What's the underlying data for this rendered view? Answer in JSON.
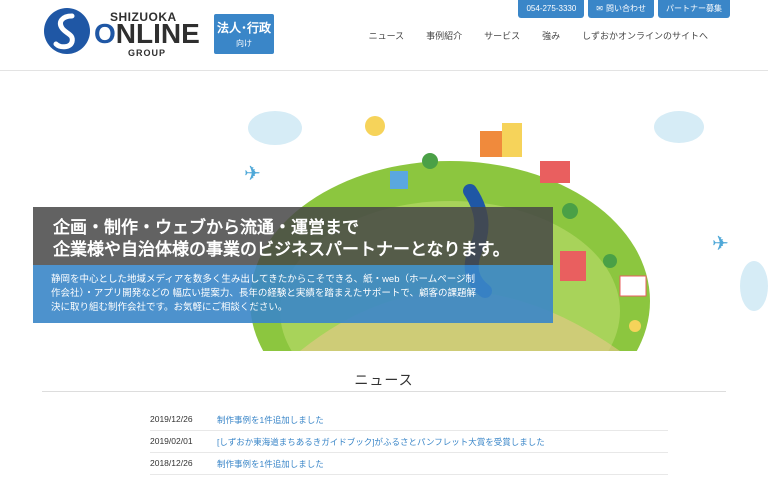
{
  "topbar": {
    "phone": "054-275-3330",
    "contact": "問い合わせ",
    "partner": "パートナー募集"
  },
  "logo": {
    "line1": "SHIZUOKA",
    "line2_a": "O",
    "line2_b": "NLINE",
    "line3": "GROUP"
  },
  "corp_button": {
    "line1": "法人･行政",
    "line2": "向け"
  },
  "nav": [
    "ニュース",
    "事例紹介",
    "サービス",
    "強み",
    "しずおかオンラインのサイトへ"
  ],
  "hero": {
    "headline1": "企画・制作・ウェブから流通・運営まで",
    "headline2": "企業様や自治体様の事業のビジネスパートナーとなります。",
    "desc1": "静岡を中心とした地域メディアを数多く生み出してきたからこそできる、紙・web（ホームページ制",
    "desc2": "作会社）・アプリ開発などの 幅広い提案力、長年の経験と実績を踏まえたサポートで、顧客の課題解",
    "desc3": "決に取り組む制作会社です。お気軽にご相談ください。"
  },
  "news": {
    "title": "ニュース",
    "items": [
      {
        "date": "2019/12/26",
        "title": "制作事例を1件追加しました"
      },
      {
        "date": "2019/02/01",
        "title": "[しずおか東海道まちあるきガイドブック]がふるさとパンフレット大賞を受賞しました"
      },
      {
        "date": "2018/12/26",
        "title": "制作事例を1件追加しました"
      }
    ]
  },
  "colors": {
    "brand": "#1f57a5",
    "accent": "#3a86c8",
    "grass": "#8cc63f"
  }
}
